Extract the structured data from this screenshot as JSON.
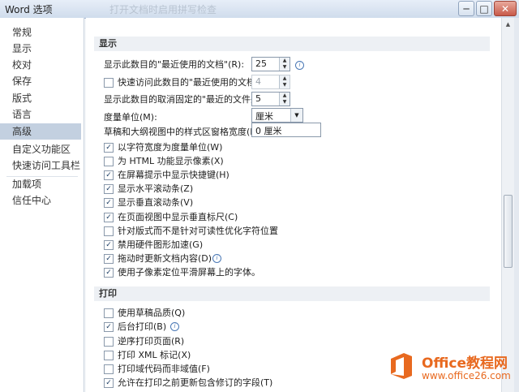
{
  "window": {
    "title": "Word 选项",
    "minimize_glyph": "─",
    "maximize_glyph": "□",
    "close_glyph": "✕",
    "ghost_text": "打开文档时启用拼写检查"
  },
  "sidebar": {
    "items": [
      {
        "label": "常规"
      },
      {
        "label": "显示"
      },
      {
        "label": "校对"
      },
      {
        "label": "保存"
      },
      {
        "label": "版式"
      },
      {
        "label": "语言"
      },
      {
        "label": "高级"
      },
      {
        "label": "自定义功能区"
      },
      {
        "label": "快速访问工具栏"
      },
      {
        "label": "加载项"
      },
      {
        "label": "信任中心"
      }
    ],
    "selected": "高级"
  },
  "display_section": {
    "header": "显示",
    "recent_docs": {
      "label": "显示此数目的\"最近使用的文档\"(R):",
      "value": "25"
    },
    "quick_access_recent": {
      "label": "快速访问此数目的\"最近使用的文档\"(Q):",
      "value": "4",
      "checked": false
    },
    "unpinned_folders": {
      "label": "显示此数目的取消固定的\"最近的文件夹\"(F):",
      "value": "5"
    },
    "measure_unit": {
      "label": "度量单位(M):",
      "value": "厘米"
    },
    "style_area_width": {
      "label": "草稿和大纲视图中的样式区窗格宽度(E):",
      "value": "0 厘米"
    },
    "checkboxes": [
      {
        "label": "以字符宽度为度量单位(W)",
        "checked": true
      },
      {
        "label": "为 HTML 功能显示像素(X)",
        "checked": false
      },
      {
        "label": "在屏幕提示中显示快捷键(H)",
        "checked": true
      },
      {
        "label": "显示水平滚动条(Z)",
        "checked": true
      },
      {
        "label": "显示垂直滚动条(V)",
        "checked": true
      },
      {
        "label": "在页面视图中显示垂直标尺(C)",
        "checked": true
      },
      {
        "label": "针对版式而不是针对可读性优化字符位置",
        "checked": false
      },
      {
        "label": "禁用硬件图形加速(G)",
        "checked": true
      },
      {
        "label": "拖动时更新文档内容(D)",
        "checked": true
      },
      {
        "label": "使用子像素定位平滑屏幕上的字体。",
        "checked": true
      }
    ]
  },
  "print_section": {
    "header": "打印",
    "checkboxes": [
      {
        "label": "使用草稿品质(Q)",
        "checked": false
      },
      {
        "label": "后台打印(B)",
        "checked": true
      },
      {
        "label": "逆序打印页面(R)",
        "checked": false
      },
      {
        "label": "打印 XML 标记(X)",
        "checked": false
      },
      {
        "label": "打印域代码而非域值(F)",
        "checked": false
      },
      {
        "label": "允许在打印之前更新包含修订的字段(T)",
        "checked": true
      }
    ]
  },
  "watermark": {
    "line1": "Office教程网",
    "line2": "www.office26.com",
    "color": "#e8691f"
  },
  "icons": {
    "check": "✓",
    "spin_up": "▲",
    "spin_down": "▼",
    "dropdown": "▼",
    "info": "i"
  }
}
